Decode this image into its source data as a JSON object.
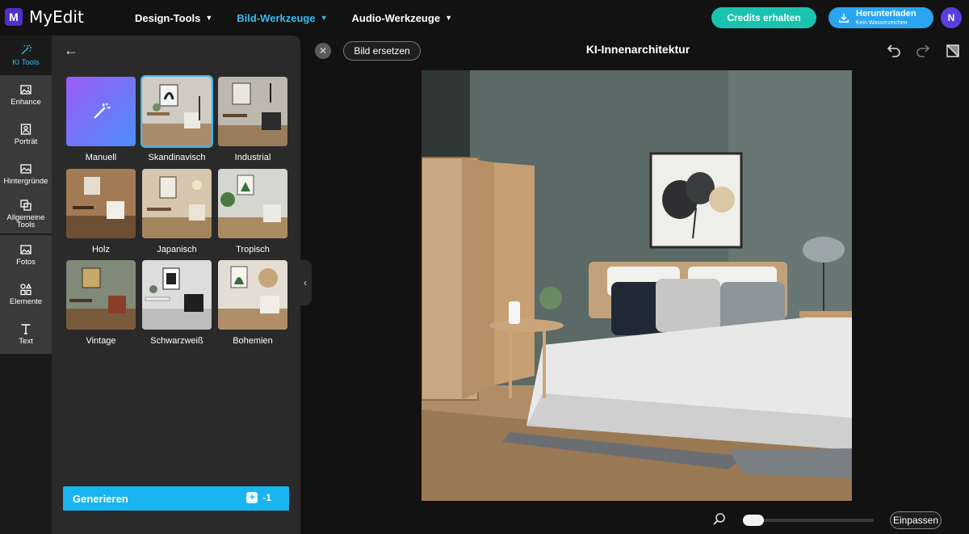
{
  "app": {
    "name": "MyEdit",
    "logo_letter": "M",
    "accent": "#3cb8f0"
  },
  "nav": [
    {
      "label": "Design-Tools",
      "active": false
    },
    {
      "label": "Bild-Werkzeuge",
      "active": true
    },
    {
      "label": "Audio-Werkzeuge",
      "active": false
    }
  ],
  "header": {
    "credits_label": "Credits erhalten",
    "download_label": "Herunterladen",
    "download_sub": "Kein Wasserzeichen",
    "avatar_initial": "N"
  },
  "rail": [
    {
      "label": "KI Tools",
      "icon": "magic-wand-icon",
      "active": true
    },
    {
      "label": "Enhance",
      "icon": "enhance-icon",
      "active": false
    },
    {
      "label": "Porträt",
      "icon": "portrait-icon",
      "active": false
    },
    {
      "label": "Hintergründe",
      "icon": "background-icon",
      "active": false
    },
    {
      "label": "Allgemeine Tools",
      "icon": "tools-icon",
      "active": false
    },
    {
      "label": "Fotos",
      "icon": "photo-icon",
      "active": false
    },
    {
      "label": "Elemente",
      "icon": "elements-icon",
      "active": false
    },
    {
      "label": "Text",
      "icon": "text-icon",
      "active": false
    }
  ],
  "styles": [
    {
      "label": "Manuell",
      "selected": false
    },
    {
      "label": "Skandinavisch",
      "selected": true
    },
    {
      "label": "Industrial",
      "selected": false
    },
    {
      "label": "Holz",
      "selected": false
    },
    {
      "label": "Japanisch",
      "selected": false
    },
    {
      "label": "Tropisch",
      "selected": false
    },
    {
      "label": "Vintage",
      "selected": false
    },
    {
      "label": "Schwarzweiß",
      "selected": false
    },
    {
      "label": "Bohemien",
      "selected": false
    }
  ],
  "generate": {
    "label": "Generieren",
    "cost": "-1"
  },
  "canvas": {
    "close_glyph": "✕",
    "replace_label": "Bild ersetzen",
    "title": "KI-Innenarchitektur",
    "fit_label": "Einpassen",
    "zoom_level": 0
  }
}
